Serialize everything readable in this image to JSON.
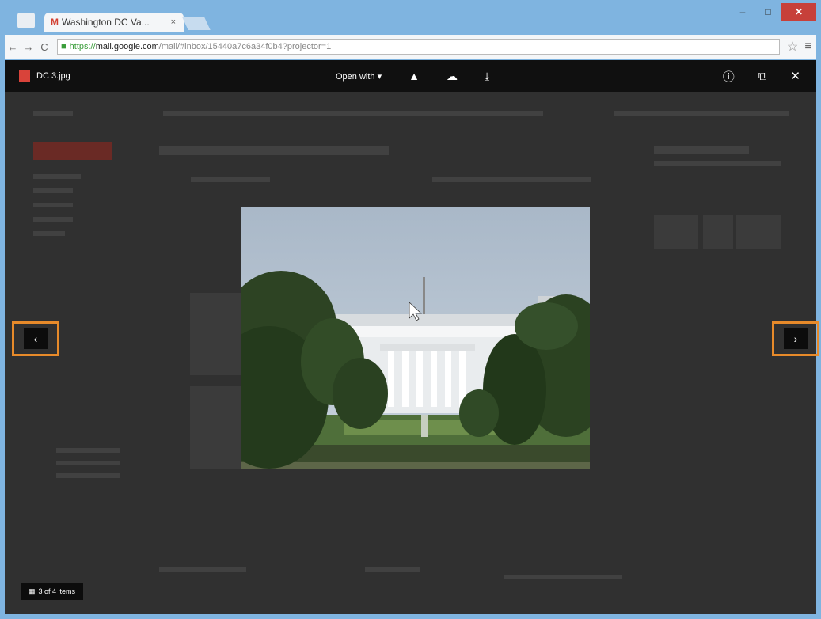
{
  "browser": {
    "tab_title": "Washington DC Va...",
    "tab_close": "×",
    "url_scheme": "https://",
    "url_host": "mail.google.com",
    "url_path": "/mail/#inbox/15440a7c6a34f0b4?projector=1",
    "back": "←",
    "forward": "→",
    "reload": "C",
    "star": "☆",
    "menu": "≡",
    "window_buttons": {
      "minimize": "–",
      "maximize": "□",
      "close": "✕"
    }
  },
  "viewer": {
    "filename": "DC 3.jpg",
    "open_with": "Open with",
    "open_with_caret": "▾",
    "icons": {
      "add_to_drive": "▲",
      "save": "☁",
      "download": "⤓",
      "details": "ⓘ",
      "popout": "⧉",
      "close": "✕"
    },
    "prev": "‹",
    "next": "›",
    "counter": "3 of 4 items",
    "grid_icon": "▦"
  }
}
